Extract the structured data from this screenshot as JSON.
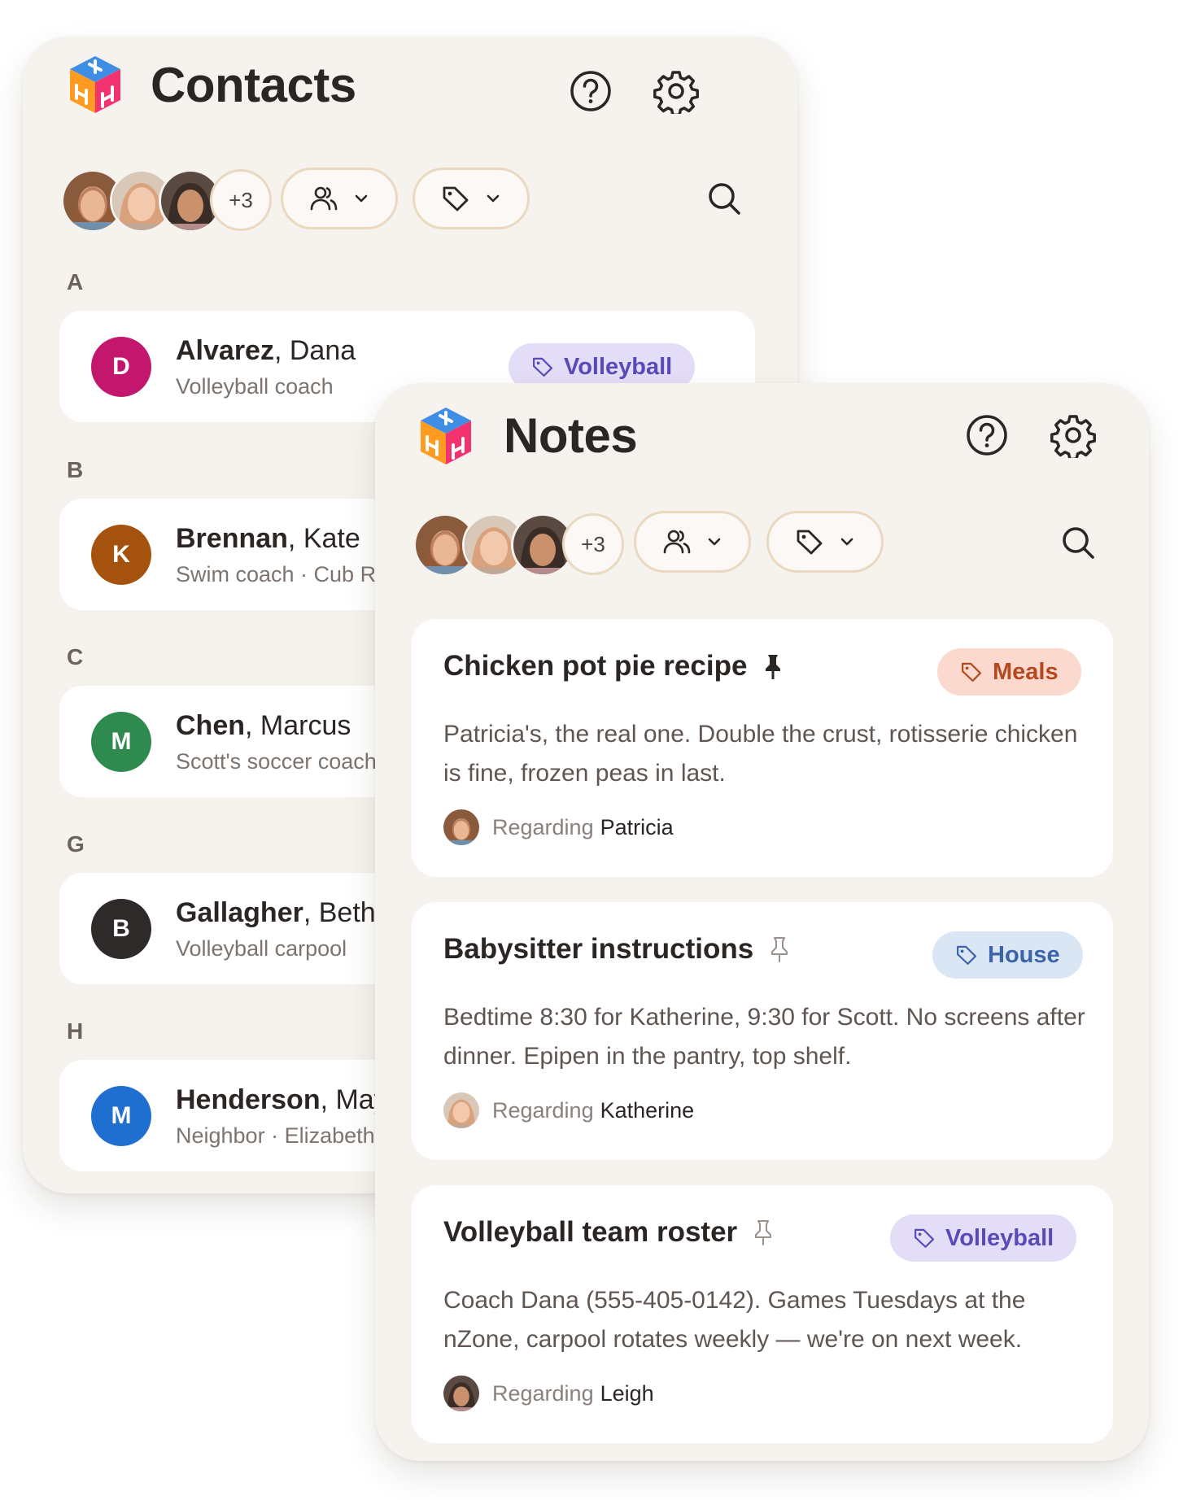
{
  "contacts": {
    "title": "Contacts",
    "more_count": "+3",
    "sections": [
      {
        "letter": "A",
        "last": "Alvarez",
        "first": ", Dana",
        "subtitle": "Volleyball coach",
        "initial": "D",
        "color": "#c3176d",
        "tag": "Volleyball"
      },
      {
        "letter": "B",
        "last": "Brennan",
        "first": ", Kate",
        "subtitle": "Swim coach · Cub R",
        "initial": "K",
        "color": "#a5520f"
      },
      {
        "letter": "C",
        "last": "Chen",
        "first": ", Marcus",
        "subtitle": "Scott's soccer coach",
        "initial": "M",
        "color": "#2f8a4f"
      },
      {
        "letter": "G",
        "last": "Gallagher",
        "first": ", Beth",
        "subtitle": "Volleyball carpool",
        "initial": "B",
        "color": "#2e2a29"
      },
      {
        "letter": "H",
        "last": "Henderson",
        "first": ", May",
        "subtitle": "Neighbor · Elizabeth",
        "initial": "M",
        "color": "#1f6fd1"
      }
    ]
  },
  "notes": {
    "title": "Notes",
    "more_count": "+3",
    "items": [
      {
        "title": "Chicken pot pie recipe",
        "pinned": true,
        "tag": "Meals",
        "body": "Patricia's, the real one. Double the crust, rotisserie chicken is fine, frozen peas in last.",
        "regarding_label": "Regarding",
        "regarding_name": "Patricia"
      },
      {
        "title": "Babysitter instructions",
        "pinned": false,
        "tag": "House",
        "body": "Bedtime 8:30 for Katherine, 9:30 for Scott. No screens after dinner. Epipen in the pantry, top shelf.",
        "regarding_label": "Regarding",
        "regarding_name": "Katherine"
      },
      {
        "title": "Volleyball team roster",
        "pinned": false,
        "tag": "Volleyball",
        "body": "Coach Dana (555-405-0142). Games Tuesdays at the nZone, carpool rotates weekly — we're on next week.",
        "regarding_label": "Regarding",
        "regarding_name": "Leigh"
      }
    ]
  },
  "colors": {
    "panel_bg": "#f6f2ee",
    "border_tan": "#ead9c1",
    "tag_volleyball": "#e4ddf7",
    "tag_meals": "#fbd9cf",
    "tag_house": "#dbe6f5"
  },
  "icons": [
    "app-logo-icon",
    "help-icon",
    "gear-icon",
    "people-icon",
    "tag-icon",
    "chevron-down-icon",
    "search-icon",
    "pin-icon",
    "pin-outline-icon"
  ]
}
